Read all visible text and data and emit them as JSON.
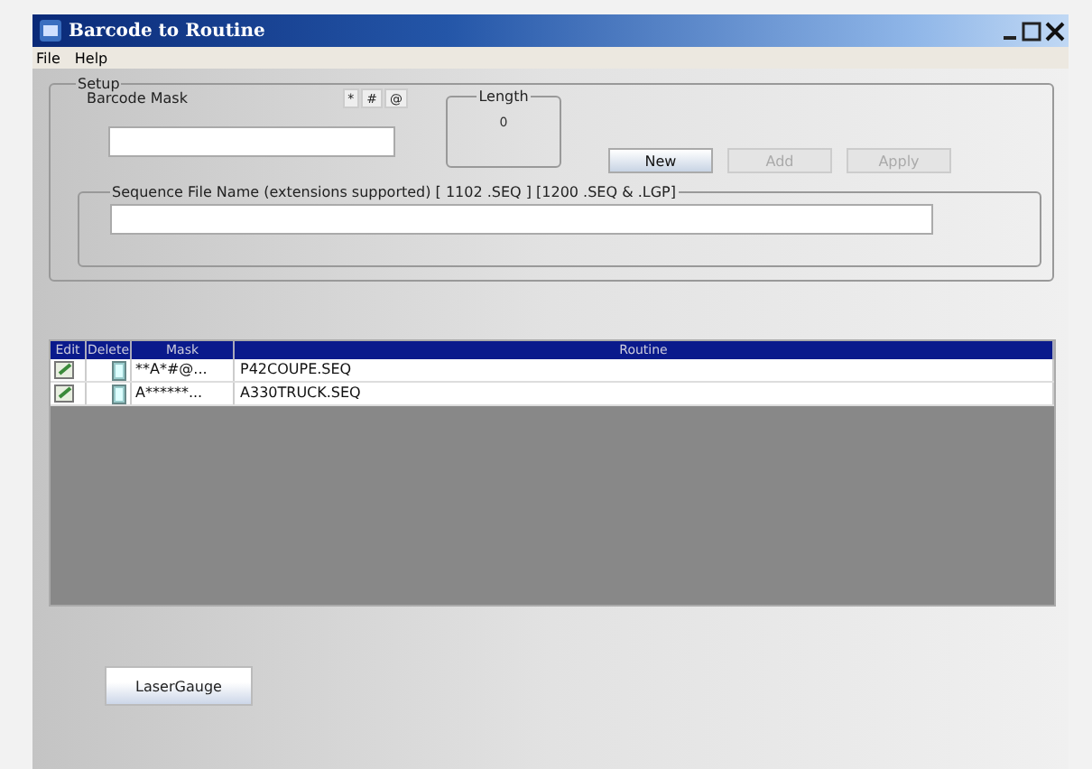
{
  "window": {
    "title": "Barcode to Routine"
  },
  "menu": [
    "File",
    "Help"
  ],
  "setup": {
    "title": "Setup",
    "barcode_mask": {
      "label": "Barcode Mask"
    },
    "symbols": [
      "*",
      "#",
      "@"
    ],
    "length": {
      "label": "Length",
      "value": "0"
    },
    "buttons": [
      {
        "label": "New",
        "disabled": false
      },
      {
        "label": "Add",
        "disabled": true
      },
      {
        "label": "Apply",
        "disabled": true
      }
    ],
    "sequence_file": {
      "label": "Sequence File Name (extensions supported) [ 1102 .SEQ ] [1200 .SEQ & .LGP]"
    }
  },
  "table": {
    "columns": [
      "Edit",
      "Delete",
      "Mask",
      "Routine"
    ],
    "rows": [
      {
        "mask": "**A*#@...",
        "routine": "P42COUPE.SEQ"
      },
      {
        "mask": "A******...",
        "routine": "A330TRUCK.SEQ"
      }
    ]
  },
  "footer_button": "LaserGauge"
}
